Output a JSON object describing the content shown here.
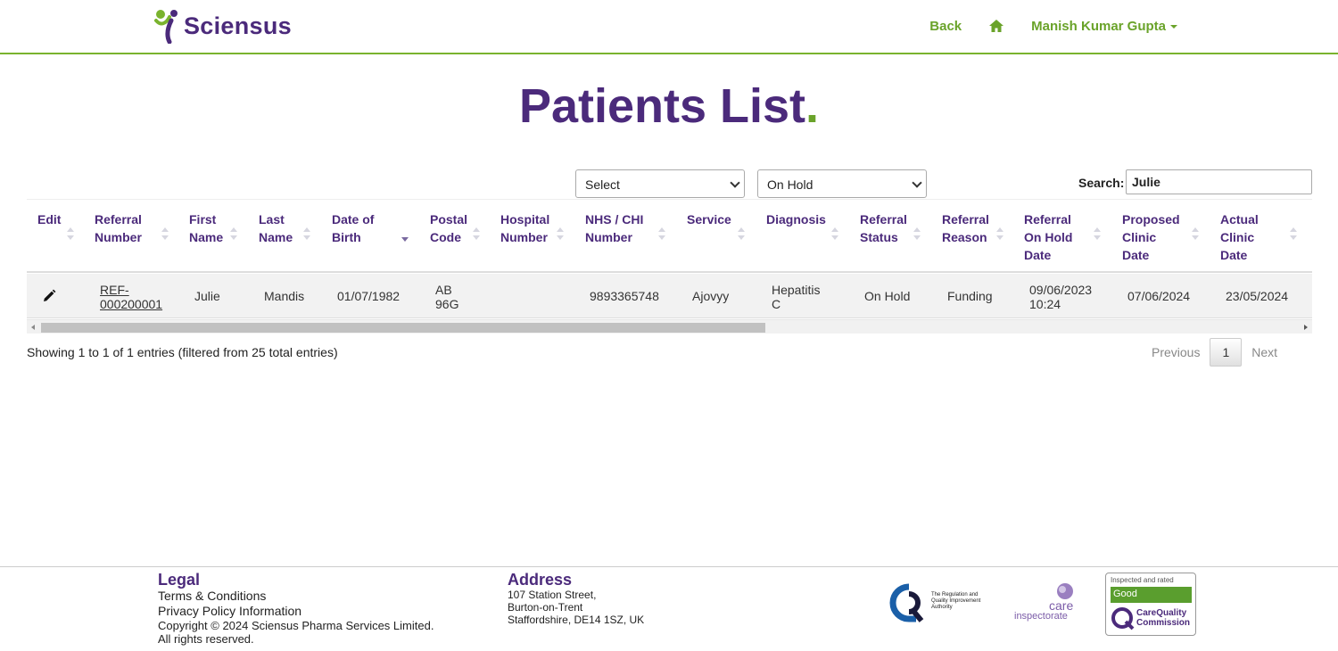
{
  "brand": {
    "name": "Sciensus",
    "accent": "#4b2a7b",
    "green": "#6aa32a"
  },
  "nav": {
    "back_label": "Back",
    "home_icon": "home-icon",
    "user_name": "Manish Kumar Gupta"
  },
  "page": {
    "title": "Patients List",
    "title_dot": "."
  },
  "filters": {
    "select1_value": "Select",
    "select2_value": "On Hold",
    "search_label": "Search:",
    "search_value": "Julie"
  },
  "table": {
    "columns": [
      "Edit",
      "Referral Number",
      "First Name",
      "Last Name",
      "Date of Birth",
      "Postal Code",
      "Hospital Number",
      "NHS / CHI Number",
      "Service",
      "Diagnosis",
      "Referral Status",
      "Referral Reason",
      "Referral On Hold Date",
      "Proposed Clinic Date",
      "Actual Clinic Date"
    ],
    "rows": [
      {
        "referral_number": "REF-000200001",
        "first_name": "Julie",
        "last_name": "Mandis",
        "dob": "01/07/1982",
        "postal_code": "AB 96G",
        "hospital_number": "",
        "nhs_number": "9893365748",
        "service": "Ajovyy",
        "diagnosis": "Hepatitis C",
        "status": "On Hold",
        "reason": "Funding",
        "on_hold_date": "09/06/2023 10:24",
        "proposed_date": "07/06/2024",
        "actual_date": "23/05/2024"
      }
    ]
  },
  "pagination": {
    "info": "Showing 1 to 1 of 1 entries (filtered from 25 total entries)",
    "previous": "Previous",
    "page": "1",
    "next": "Next"
  },
  "footer": {
    "legal_heading": "Legal",
    "terms": "Terms & Conditions",
    "privacy": "Privacy Policy Information",
    "copyright": "Copyright © 2024 Sciensus Pharma Services Limited.",
    "rights": "All rights reserved.",
    "address_heading": "Address",
    "address_line1": "107 Station Street,",
    "address_line2": "Burton-on-Trent",
    "address_line3": "Staffordshire, DE14 1SZ, UK",
    "rqia_text": "The Regulation and Quality Improvement Authority",
    "care_text": "care inspectorate",
    "cqc_top": "Inspected and rated",
    "cqc_rating": "Good",
    "cqc_name": "CareQuality Commission"
  }
}
